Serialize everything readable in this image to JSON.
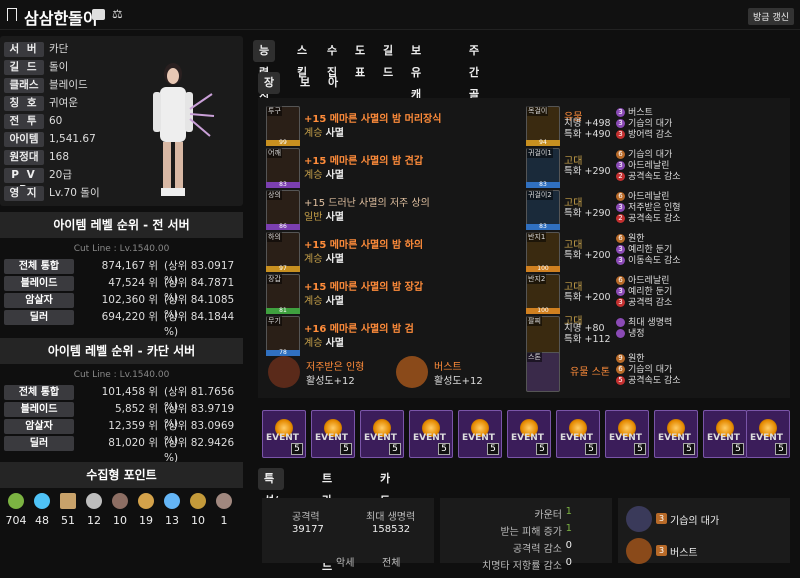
{
  "header": {
    "title": "삼삼한돌이",
    "refresh": "방금 갱신"
  },
  "profile": [
    {
      "label": "서 버",
      "value": "카단"
    },
    {
      "label": "길 드",
      "value": "돌이"
    },
    {
      "label": "클래스",
      "value": "블레이드"
    },
    {
      "label": "칭 호",
      "value": "귀여운"
    },
    {
      "label": "전 투",
      "value": "60"
    },
    {
      "label": "아이템",
      "value": "1,541.67"
    },
    {
      "label": "원정대",
      "value": "168"
    },
    {
      "label": "P V P",
      "value": "20급"
    },
    {
      "label": "영 지",
      "value": "Lv.70 돌이"
    }
  ],
  "rank_all": {
    "title": "아이템 레벨 순위 - 전 서버",
    "cutline": "Cut Line : Lv.1540.00",
    "rows": [
      {
        "label": "전체 통합",
        "rank": "874,167 위",
        "pct": "(상위 83.0917 %)"
      },
      {
        "label": "블레이드",
        "rank": "47,524 위",
        "pct": "(상위 84.7871 %)"
      },
      {
        "label": "암살자",
        "rank": "102,360 위",
        "pct": "(상위 84.1085 %)"
      },
      {
        "label": "딜러",
        "rank": "694,220 위",
        "pct": "(상위 84.1844 %)"
      }
    ]
  },
  "rank_server": {
    "title": "아이템 레벨 순위 - 카단 서버",
    "cutline": "Cut Line : Lv.1540.00",
    "rows": [
      {
        "label": "전체 통합",
        "rank": "101,458 위",
        "pct": "(상위 81.7656 %)"
      },
      {
        "label": "블레이드",
        "rank": "5,852 위",
        "pct": "(상위 83.9719 %)"
      },
      {
        "label": "암살자",
        "rank": "12,359 위",
        "pct": "(상위 83.0969 %)"
      },
      {
        "label": "딜러",
        "rank": "81,020 위",
        "pct": "(상위 82.9426 %)"
      }
    ]
  },
  "collect": {
    "title": "수집형 포인트",
    "values": [
      "704",
      "48",
      "51",
      "12",
      "10",
      "19",
      "13",
      "10",
      "1"
    ]
  },
  "tabs": [
    "능력치",
    "스킬",
    "수집",
    "도표",
    "길드",
    "보유 캐릭터",
    "주간골드획득"
  ],
  "subtabs": [
    "장비",
    "보석",
    "아바타"
  ],
  "equip_left": [
    {
      "slot": "투구",
      "q": "99",
      "name": "+15 메마른 사멸의 밤 머리장식",
      "set": "계승",
      "setname": "사멸"
    },
    {
      "slot": "어깨",
      "q": "83",
      "name": "+15 메마른 사멸의 밤 견갑",
      "set": "계승",
      "setname": "사멸"
    },
    {
      "slot": "상의",
      "q": "86",
      "name": "+15 드러난 사멸의 저주 상의",
      "set": "일반",
      "setname": "사멸"
    },
    {
      "slot": "하의",
      "q": "97",
      "name": "+15 메마른 사멸의 밤 하의",
      "set": "계승",
      "setname": "사멸"
    },
    {
      "slot": "장갑",
      "q": "81",
      "name": "+15 메마른 사멸의 밤 장갑",
      "set": "계승",
      "setname": "사멸"
    },
    {
      "slot": "무기",
      "q": "78",
      "name": "+16 메마른 사멸의 밤 검",
      "set": "계승",
      "setname": "사멸"
    }
  ],
  "bottom_left": [
    {
      "name": "저주받은 인형",
      "lv": "활성도+12"
    },
    {
      "name": "버스트",
      "lv": "활성도+12"
    }
  ],
  "equip_right": [
    {
      "slot": "목걸이",
      "q": "94",
      "grade": "유물",
      "stats": [
        "치명 +498",
        "특화 +490"
      ],
      "eng": [
        [
          "3",
          "버스트"
        ],
        [
          "3",
          "기습의 대가"
        ],
        [
          "3",
          "방어력 감소"
        ]
      ]
    },
    {
      "slot": "귀걸이1",
      "q": "83",
      "grade": "고대",
      "stats": [
        "특화 +290"
      ],
      "eng": [
        [
          "6",
          "기습의 대가"
        ],
        [
          "3",
          "아드레날린"
        ],
        [
          "2",
          "공격속도 감소"
        ]
      ]
    },
    {
      "slot": "귀걸이2",
      "q": "83",
      "grade": "고대",
      "stats": [
        "특화 +290"
      ],
      "eng": [
        [
          "6",
          "아드레날린"
        ],
        [
          "3",
          "저주받은 인형"
        ],
        [
          "2",
          "공격속도 감소"
        ]
      ]
    },
    {
      "slot": "반지1",
      "q": "100",
      "grade": "고대",
      "stats": [
        "특화 +200"
      ],
      "eng": [
        [
          "6",
          "원한"
        ],
        [
          "3",
          "예리한 둔기"
        ],
        [
          "3",
          "이동속도 감소"
        ]
      ]
    },
    {
      "slot": "반지2",
      "q": "100",
      "grade": "고대",
      "stats": [
        "특화 +200"
      ],
      "eng": [
        [
          "6",
          "아드레날린"
        ],
        [
          "3",
          "예리한 둔기"
        ],
        [
          "3",
          "공격력 감소"
        ]
      ]
    },
    {
      "slot": "팔찌",
      "q": "",
      "grade": "고대",
      "stats": [
        "치명 +80",
        "특화 +112"
      ],
      "eng": [
        [
          "",
          "최대 생명력"
        ],
        [
          "",
          "냉정"
        ]
      ]
    }
  ],
  "stone": {
    "slot": "스톤",
    "grade": "유물 스톤",
    "eng": [
      [
        "9",
        "원한"
      ],
      [
        "6",
        "기습의 대가"
      ],
      [
        "5",
        "공격속도 감소"
      ]
    ]
  },
  "cards": {
    "label": "EVENT",
    "count": "5"
  },
  "bottomtabs": [
    "특성/각인",
    "트라이포드",
    "카드"
  ],
  "stats": {
    "atk_label": "공격력",
    "atk": "39177",
    "hp_label": "최대 생명력",
    "hp": "158532",
    "c1": "악세",
    "c2": "전체"
  },
  "mid": {
    "counter_label": "카운터",
    "counter": "1",
    "dmg_label": "받는 피해 증가",
    "dmg": "1",
    "atkdown_label": "공격력 감소",
    "atkdown": "0",
    "last_label": "치명타 저항률 감소",
    "last": "0"
  },
  "engraves": [
    {
      "lvl": "3",
      "name": "기습의 대가"
    },
    {
      "lvl": "3",
      "name": "버스트"
    }
  ],
  "colors": {
    "orange": "#ff8c3a",
    "gold": "#c8a24a",
    "bg": "#0f0f0f"
  }
}
